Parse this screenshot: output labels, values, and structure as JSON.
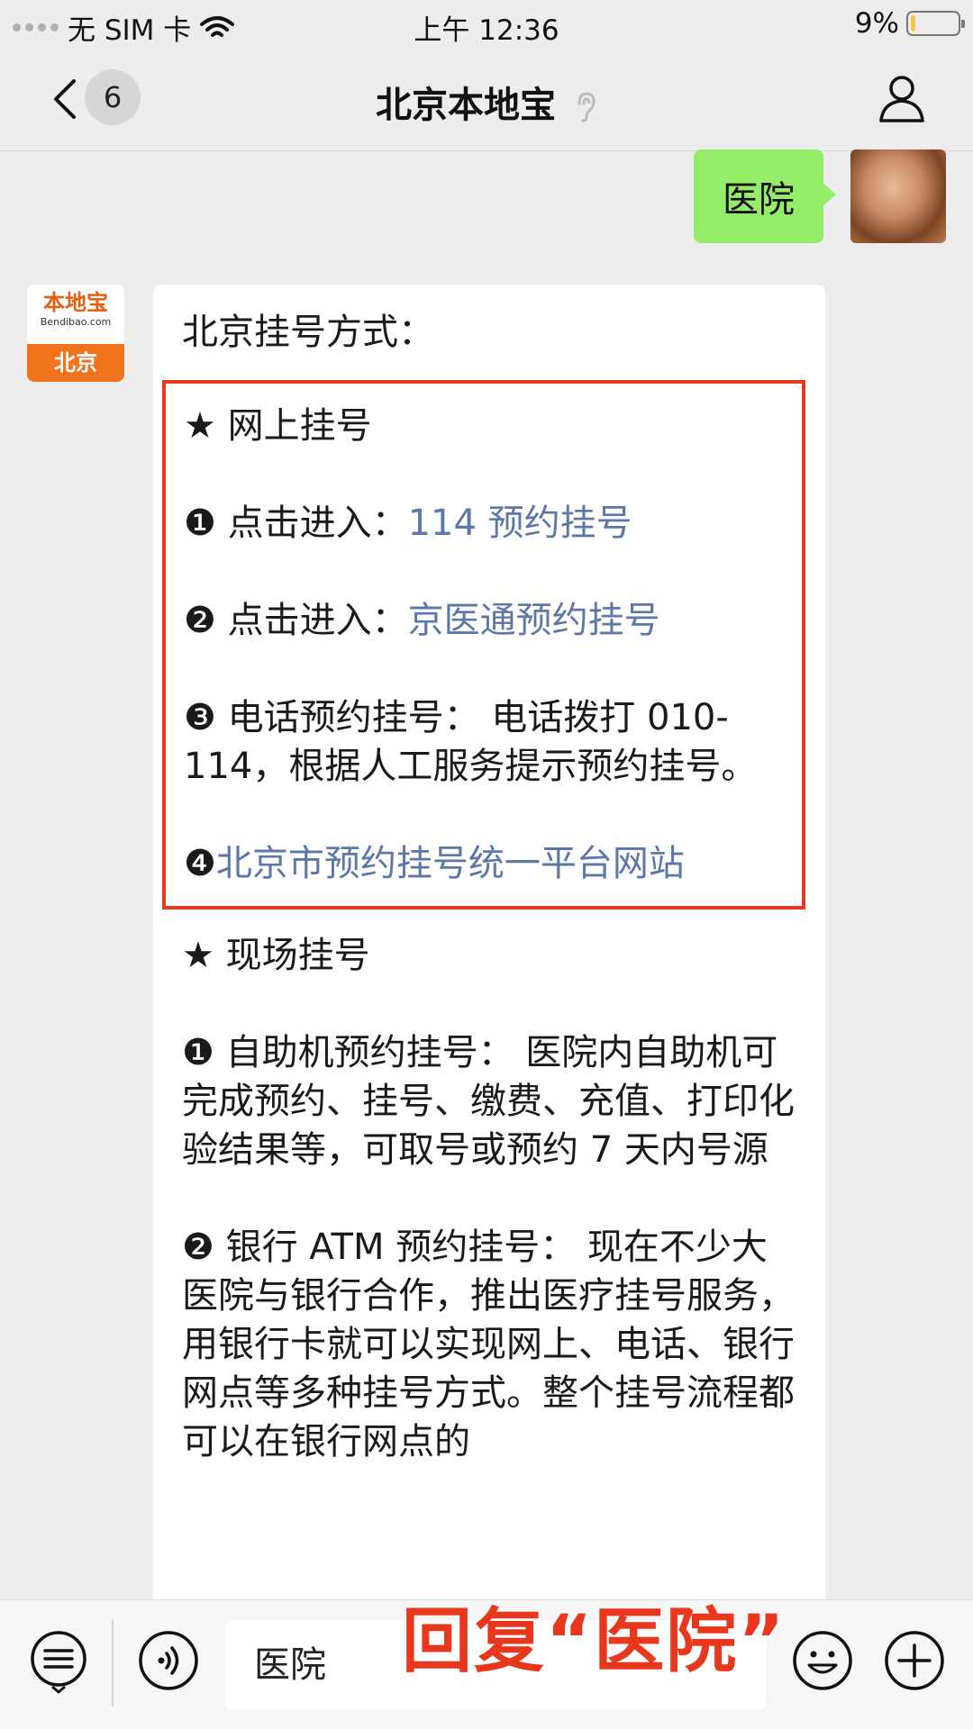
{
  "status_bar": {
    "carrier": "无 SIM 卡",
    "time": "上午 12:36",
    "battery": "9%",
    "battery_level": 0.09
  },
  "nav": {
    "badge_count": "6",
    "title": "北京本地宝"
  },
  "chat": {
    "user_message": "医院",
    "bot_avatar": {
      "logo": "本地宝",
      "site": "Bendibao.com",
      "city": "北京"
    },
    "bot_reply": {
      "intro": "北京挂号方式：",
      "online": {
        "heading": "★ 网上挂号",
        "item1_prefix": "❶ 点击进入：",
        "item1_link": "114 预约挂号",
        "item2_prefix": "❷ 点击进入：",
        "item2_link": "京医通预约挂号",
        "item3": "❸ 电话预约挂号：  电话拨打 010-114，根据人工服务提示预约挂号。",
        "item4_prefix": "❹",
        "item4_link": "北京市预约挂号统一平台网站"
      },
      "onsite": {
        "heading": "★ 现场挂号",
        "item1": "❶ 自助机预约挂号：  医院内自助机可完成预约、挂号、缴费、充值、打印化验结果等，可取号或预约 7 天内号源",
        "item2": "❷ 银行 ATM 预约挂号：  现在不少大医院与银行合作，推出医疗挂号服务，用银行卡就可以实现网上、电话、银行网点等多种挂号方式。整个挂号流程都可以在银行网点的"
      }
    }
  },
  "input": {
    "value": "医院"
  },
  "overlay_caption": "回复“医院”",
  "icons": {
    "back": "chevron-left-icon",
    "profile": "person-icon",
    "ear": "ear-icon",
    "menu": "menu-icon",
    "voice": "voice-icon",
    "emoji": "emoji-icon",
    "add": "plus-icon"
  },
  "colors": {
    "user_bubble": "#95ec69",
    "link": "#5d77a8",
    "highlight_border": "#e23b1e",
    "logo_orange": "#f0731e"
  }
}
